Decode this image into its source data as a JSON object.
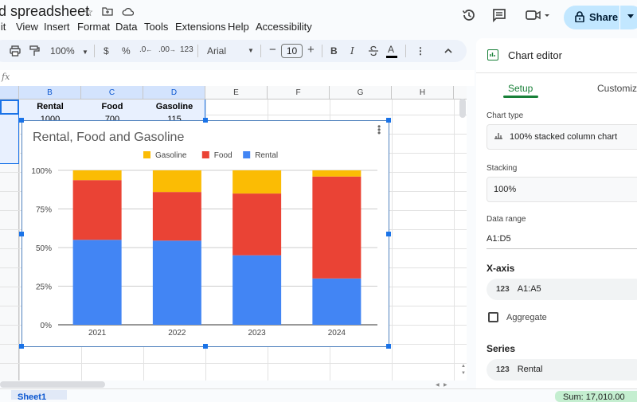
{
  "app": {
    "doc_title": "d spreadsheet",
    "menu": [
      "lit",
      "View",
      "Insert",
      "Format",
      "Data",
      "Tools",
      "Extensions",
      "Help",
      "Accessibility"
    ],
    "share_label": "Share"
  },
  "toolbar": {
    "zoom": "100%",
    "currency": "$",
    "percent": "%",
    "decrease_decimal": ".0",
    "increase_decimal": ".00",
    "number_format": "123",
    "font": "Arial",
    "font_size": "10",
    "bold": "B",
    "italic": "I",
    "text_color": "A"
  },
  "formula_bar": {
    "fx": "fx",
    "value": ""
  },
  "grid": {
    "columns": [
      "B",
      "C",
      "D",
      "E",
      "F",
      "G",
      "H"
    ],
    "selected_columns": [
      "B",
      "C",
      "D"
    ],
    "header_row": [
      "Rental",
      "Food",
      "Gasoline"
    ],
    "first_data_row": [
      "1000",
      "700",
      "115"
    ]
  },
  "chart": {
    "menu_icon": "more-vert"
  },
  "chart_data": {
    "type": "bar",
    "stacking": "100%",
    "title": "Rental, Food and Gasoline",
    "xlabel": "",
    "ylabel": "",
    "categories": [
      "2021",
      "2022",
      "2023",
      "2024"
    ],
    "series": [
      {
        "name": "Rental",
        "color": "#4285f4",
        "values": [
          55,
          54.5,
          45,
          30
        ]
      },
      {
        "name": "Food",
        "color": "#ea4335",
        "values": [
          38.7,
          31.5,
          40,
          66
        ]
      },
      {
        "name": "Gasoline",
        "color": "#fbbc04",
        "values": [
          6.3,
          14,
          15,
          4
        ]
      }
    ],
    "legend_order": [
      "Gasoline",
      "Food",
      "Rental"
    ],
    "legend_position": "top",
    "yticks": [
      "0%",
      "25%",
      "50%",
      "75%",
      "100%"
    ],
    "ylim": [
      0,
      100
    ],
    "grid": true
  },
  "editor": {
    "title": "Chart editor",
    "tabs": [
      "Setup",
      "Customize"
    ],
    "chart_type_label": "Chart type",
    "chart_type_value": "100% stacked column chart",
    "stacking_label": "Stacking",
    "stacking_value": "100%",
    "data_range_label": "Data range",
    "data_range_value": "A1:D5",
    "x_axis_label": "X-axis",
    "x_axis_value": "A1:A5",
    "aggregate_label": "Aggregate",
    "aggregate_checked": false,
    "series_label": "Series",
    "series_value": "Rental",
    "num_icon": "123"
  },
  "footer": {
    "sheet_tab": "Sheet1",
    "sum": "Sum: 17,010.00"
  }
}
